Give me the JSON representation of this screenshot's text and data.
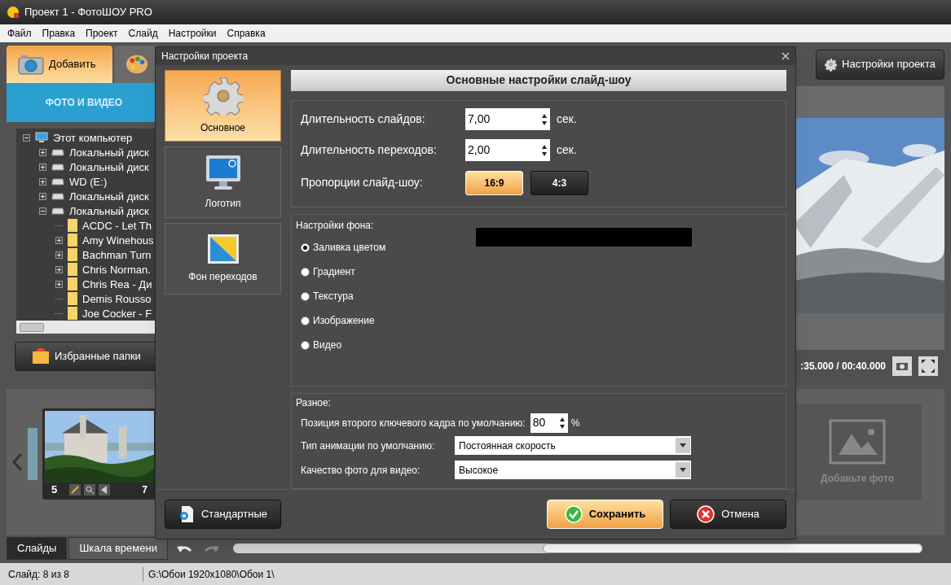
{
  "window": {
    "title": "Проект 1 - ФотоШОУ PRO"
  },
  "menu": [
    "Файл",
    "Правка",
    "Проект",
    "Слайд",
    "Настройки",
    "Справка"
  ],
  "left_panel": {
    "tabs": [
      {
        "kind": "camera",
        "label": "Добавить",
        "selected": true
      },
      {
        "kind": "palette",
        "selected": false
      }
    ],
    "section_title": "ФОТО И ВИДЕО",
    "tree": [
      {
        "label": "Этот компьютер",
        "kind": "computer",
        "expandable": true,
        "expanded": true,
        "children": [
          {
            "label": "Локальный диск",
            "kind": "drive",
            "expandable": true,
            "expanded": false
          },
          {
            "label": "Локальный диск",
            "kind": "drive",
            "expandable": true,
            "expanded": false
          },
          {
            "label": "WD (E:)",
            "kind": "drive",
            "expandable": true,
            "expanded": false
          },
          {
            "label": "Локальный диск",
            "kind": "drive",
            "expandable": true,
            "expanded": false
          },
          {
            "label": "Локальный диск",
            "kind": "drive",
            "expandable": true,
            "expanded": true,
            "children": [
              {
                "label": "ACDC - Let Th",
                "kind": "folder",
                "expandable": false
              },
              {
                "label": "Amy Winehous",
                "kind": "folder",
                "expandable": true
              },
              {
                "label": "Bachman Turn",
                "kind": "folder",
                "expandable": true
              },
              {
                "label": "Chris Norman.",
                "kind": "folder",
                "expandable": true
              },
              {
                "label": "Chris Rea - Ди",
                "kind": "folder",
                "expandable": true
              },
              {
                "label": "Demis Rousso",
                "kind": "folder",
                "expandable": false
              },
              {
                "label": "Joe Cocker - F",
                "kind": "folder",
                "expandable": false
              }
            ]
          }
        ]
      }
    ],
    "favorites_button": "Избранные папки"
  },
  "project_settings_button": "Настройки проекта",
  "preview": {
    "time": ":35.000 / 00:40.000"
  },
  "slide": {
    "number": "5",
    "duration": "7"
  },
  "add_photo": "Добавьте фото",
  "bottom_tabs": [
    {
      "label": "Слайды",
      "selected": true
    },
    {
      "label": "Шкала времени",
      "selected": false
    }
  ],
  "status_bar": {
    "slide": "Слайд: 8 из 8",
    "path": "G:\\Обои 1920x1080\\Обои 1\\"
  },
  "dialog": {
    "title": "Настройки проекта",
    "nav": [
      {
        "label": "Основное",
        "kind": "gear",
        "selected": true
      },
      {
        "label": "Логотип",
        "kind": "monitor",
        "selected": false
      },
      {
        "label": "Фон переходов",
        "kind": "gradient",
        "selected": false
      }
    ],
    "heading": "Основные настройки слайд-шоу",
    "durations": [
      {
        "label": "Длительность слайдов:",
        "value": "7,00",
        "unit": "сек."
      },
      {
        "label": "Длительность переходов:",
        "value": "2,00",
        "unit": "сек."
      }
    ],
    "aspect": {
      "label": "Пропорции слайд-шоу:",
      "options": [
        {
          "label": "16:9",
          "selected": true
        },
        {
          "label": "4:3",
          "selected": false
        }
      ]
    },
    "background": {
      "title": "Настройки фона:",
      "color": "#000000",
      "options": [
        {
          "label": "Заливка цветом",
          "selected": true
        },
        {
          "label": "Градиент",
          "selected": false
        },
        {
          "label": "Текстура",
          "selected": false
        },
        {
          "label": "Изображение",
          "selected": false
        },
        {
          "label": "Видео",
          "selected": false
        }
      ]
    },
    "misc": {
      "title": "Разное:",
      "keyframe": {
        "label": "Позиция второго ключевого кадра по умолчанию:",
        "value": "80",
        "unit": "%"
      },
      "selects": [
        {
          "label": "Тип анимации по умолчанию:",
          "value": "Постоянная скорость"
        },
        {
          "label": "Качество фото для видео:",
          "value": "Высокое"
        }
      ]
    },
    "buttons": [
      {
        "label": "Стандартные",
        "kind": "defaults"
      },
      {
        "label": "Сохранить",
        "kind": "save"
      },
      {
        "label": "Отмена",
        "kind": "cancel"
      }
    ]
  }
}
